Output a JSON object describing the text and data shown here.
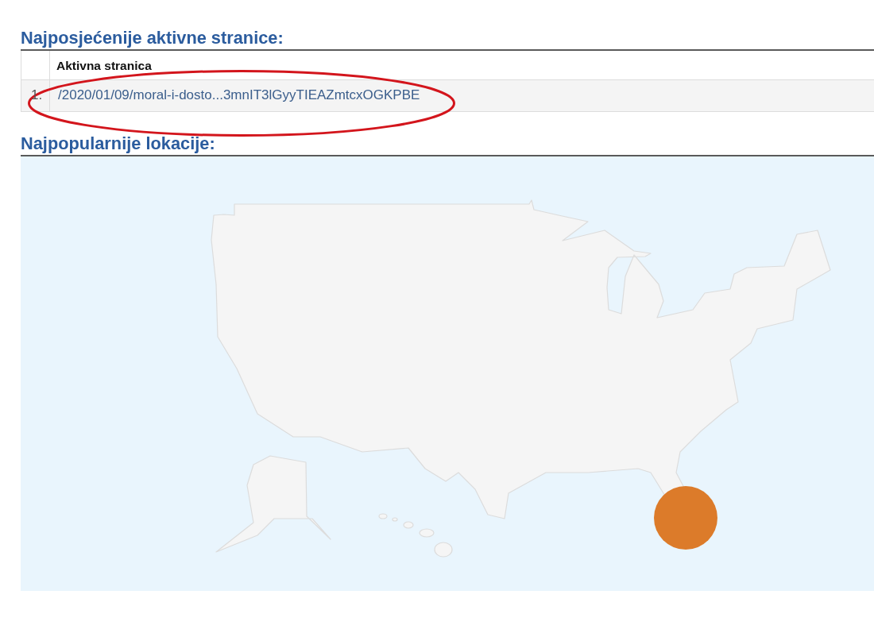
{
  "sections": [
    {
      "kind": "table",
      "heading": "Najposjećenije aktivne stranice:",
      "table": {
        "columns": [
          "Aktivna stranica"
        ],
        "rows": [
          {
            "index": "1.",
            "page": "/2020/01/09/moral-i-dosto...3mnIT3lGyyTIEAZmtcxOGKPBE",
            "highlighted": true
          }
        ]
      }
    },
    {
      "kind": "map",
      "heading": "Najpopularnije lokacije:"
    }
  ]
}
